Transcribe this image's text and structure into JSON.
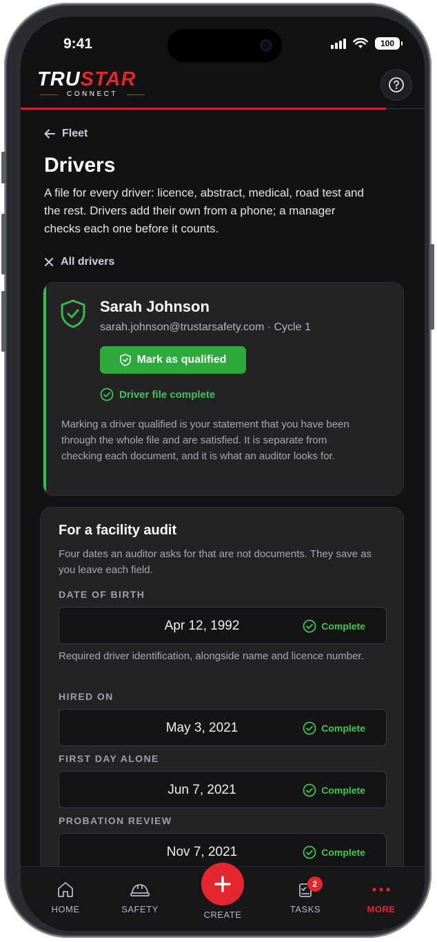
{
  "status_bar": {
    "time": "9:41",
    "battery": "100"
  },
  "header": {
    "logo_main_white": "TRU",
    "logo_main_red": "STAR",
    "logo_sub": "CONNECT",
    "help_icon": "question-circle-icon"
  },
  "nav": {
    "back_label": "Fleet"
  },
  "page": {
    "title": "Drivers",
    "description": "A file for every driver: licence, abstract, medical, road test and the rest. Drivers add their own from a phone; a manager checks each one before it counts.",
    "filter_label": "All drivers"
  },
  "driver": {
    "name": "Sarah Johnson",
    "email": "sarah.johnson@trustarsafety.com",
    "cycle": "Cycle 1",
    "qualify_button": "Mark as qualified",
    "file_status": "Driver file complete",
    "note": "Marking a driver qualified is your statement that you have been through the whole file and are satisfied. It is separate from checking each document, and it is what an auditor looks for."
  },
  "audit": {
    "title": "For a facility audit",
    "description": "Four dates an auditor asks for that are not documents. They save as you leave each field.",
    "fields": [
      {
        "label": "DATE OF BIRTH",
        "value": "Apr 12, 1992",
        "status": "Complete",
        "help": "Required driver identification, alongside name and licence number."
      },
      {
        "label": "HIRED ON",
        "value": "May 3, 2021",
        "status": "Complete"
      },
      {
        "label": "FIRST DAY ALONE",
        "value": "Jun 7, 2021",
        "status": "Complete"
      },
      {
        "label": "PROBATION REVIEW",
        "value": "Nov 7, 2021",
        "status": "Complete"
      }
    ]
  },
  "tabbar": {
    "home": "HOME",
    "safety": "SAFETY",
    "create": "CREATE",
    "tasks": "TASKS",
    "tasks_badge": "2",
    "more": "MORE"
  },
  "colors": {
    "accent_red": "#e4262f",
    "success_green": "#2eaa3c",
    "background": "#121214",
    "card": "#232326"
  }
}
